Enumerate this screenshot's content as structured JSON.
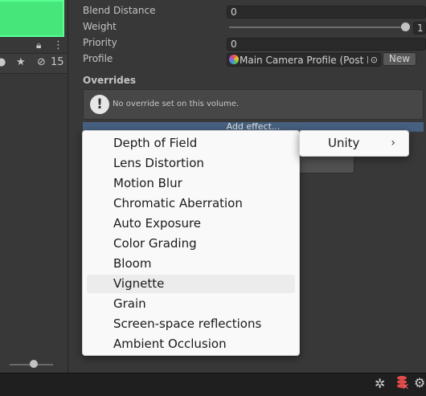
{
  "left_panel": {
    "toolbar": {
      "visibility_count": "15"
    }
  },
  "inspector": {
    "rows": {
      "blend_distance": {
        "label": "Blend Distance",
        "value": "0"
      },
      "weight": {
        "label": "Weight",
        "value": "1",
        "slider_level": 1.0
      },
      "priority": {
        "label": "Priority",
        "value": "0"
      },
      "profile": {
        "label": "Profile",
        "value": "Main Camera Profile (Post P",
        "new_button": "New"
      }
    },
    "overrides_title": "Overrides",
    "info_message": "No override set on this volume.",
    "add_effect_label": "Add effect..."
  },
  "effect_menu": {
    "items": [
      "Depth of Field",
      "Lens Distortion",
      "Motion Blur",
      "Chromatic Aberration",
      "Auto Exposure",
      "Color Grading",
      "Bloom",
      "Vignette",
      "Grain",
      "Screen-space reflections",
      "Ambient Occlusion"
    ],
    "highlighted": "Vignette"
  },
  "submenu": {
    "label": "Unity",
    "arrow": "›"
  },
  "icons": {
    "info": "info-icon",
    "lock": "lock-icon",
    "visibility": "eye-slash-icon",
    "bug": "bug-icon",
    "database_error": "database-error-icon",
    "settings": "gear-icon"
  },
  "colors": {
    "scene_preview": "#47e67a",
    "add_effect_bar": "#46607f",
    "menu_bg": "#f9f9f9",
    "menu_highlight": "#ececec"
  }
}
